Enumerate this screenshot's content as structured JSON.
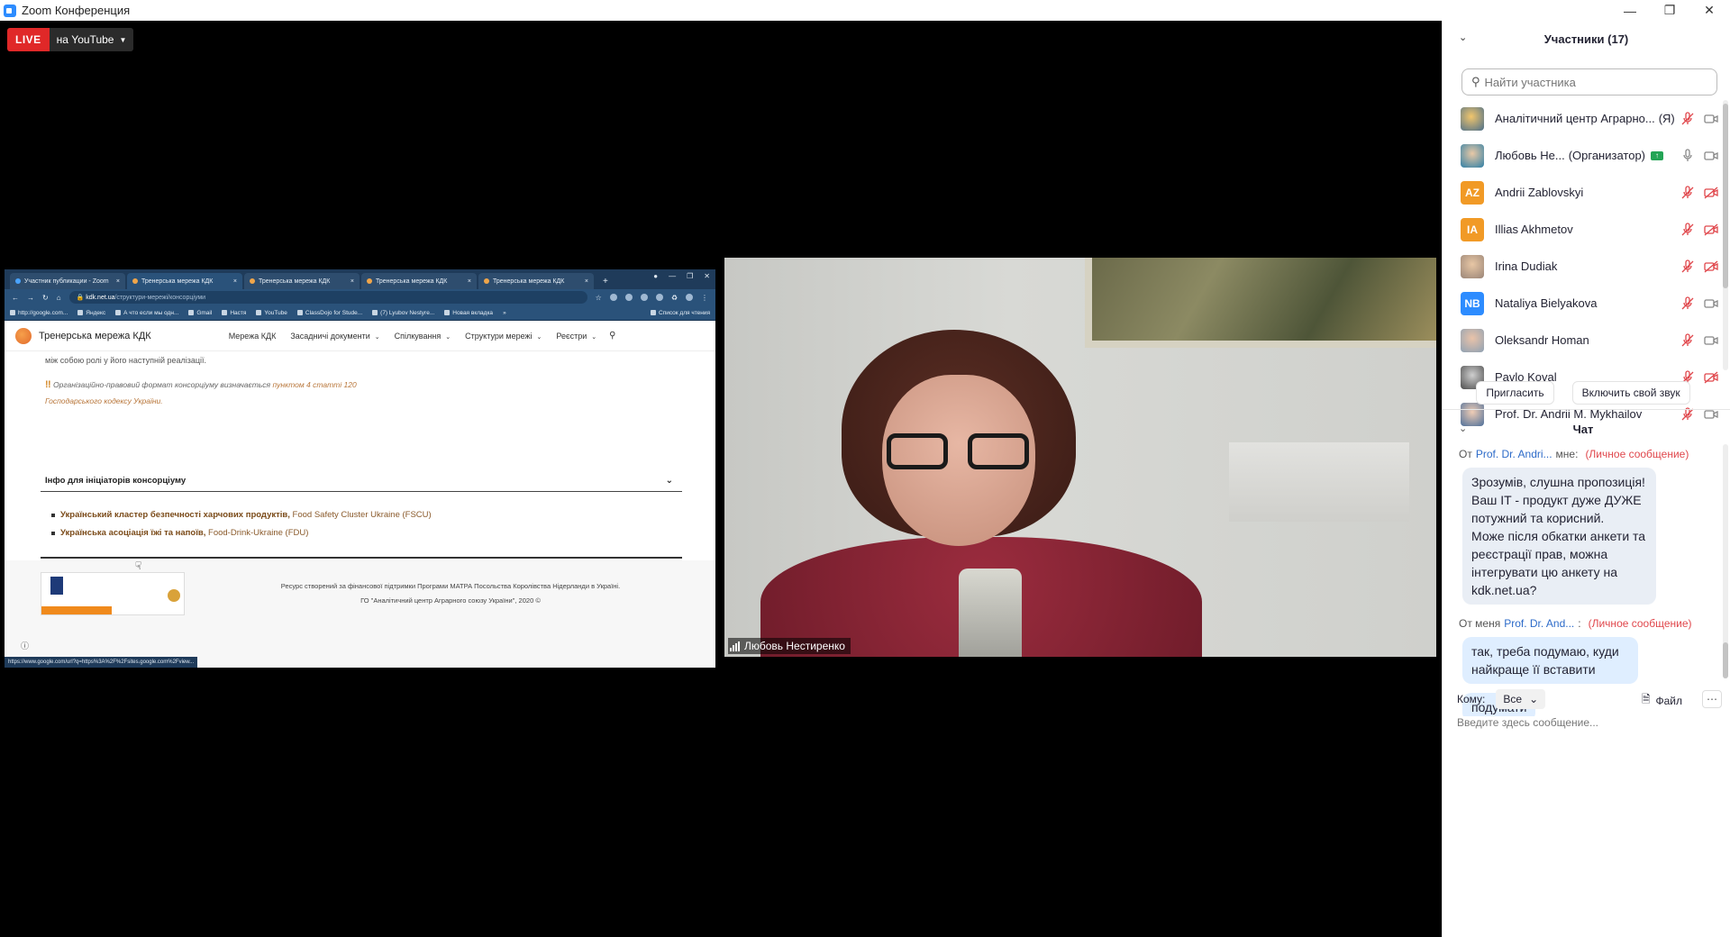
{
  "window": {
    "title": "Zoom Конференция"
  },
  "live": {
    "badge": "LIVE",
    "destination": "на YouTube"
  },
  "browser": {
    "tabs": [
      {
        "label": "Участник публикации - Zoom"
      },
      {
        "label": "Тренерська мережа КДК"
      },
      {
        "label": "Тренерська мережа КДК"
      },
      {
        "label": "Тренерська мережа КДК"
      },
      {
        "label": "Тренерська мережа КДК"
      }
    ],
    "url_host": "kdk.net.ua",
    "url_path": "/структури-мережі/консорціуми",
    "bookmarks": [
      "http://google.com...",
      "Яндекс",
      "А что если мы одн...",
      "Gmail",
      "Настя",
      "YouTube",
      "ClassDojo for Stude...",
      "(7) Lyubov Nestyre...",
      "Новая вкладка"
    ],
    "reading_list": "Список для чтения",
    "status_url": "https://www.google.com/url?q=https%3A%2F%2Fsites.google.com%2Fview..."
  },
  "site": {
    "name": "Тренерська мережа КДК",
    "menu": [
      "Мережа КДК",
      "Засадничі документи",
      "Спілкування",
      "Структури мережі",
      "Реєстри"
    ],
    "para_tail": "між собою ролі у його наступній реалізації.",
    "note_prefix": "Організаційно-правовий формат консорціуму визначається ",
    "note_link": "пунктом 4 статті 120",
    "note_link2": "Господарського кодексу України.",
    "accordion": "Інфо для ініціаторів консорціуму",
    "list": [
      {
        "bold": "Український кластер безпечності харчових продуктів,",
        "normal": "Food Safety Cluster Ukraine (FSCU)"
      },
      {
        "bold": "Українська асоціація їжі та напоїв,",
        "normal": "Food-Drink-Ukraine (FDU)"
      }
    ],
    "footer_line1": "Ресурс створений за фінансової підтримки Програми МАТРА Посольства Королівства Нідерланди в Україні.",
    "footer_line2": "ГО \"Аналітичний центр Аграрного союзу України\", 2020 ©"
  },
  "video": {
    "name": "Любовь Нестиренко"
  },
  "participants": {
    "title": "Участники (17)",
    "search_placeholder": "Найти участника",
    "list": [
      {
        "name": "Аналітичний центр Аграрно...",
        "role": "(Я)",
        "initials": "",
        "avatar": "photo1",
        "mic": "muted",
        "cam": "on"
      },
      {
        "name": "Любовь Не...",
        "role": "(Организатор)",
        "initials": "",
        "avatar": "photo2",
        "mic": "on",
        "cam": "on"
      },
      {
        "name": "Andrii Zablovskyi",
        "role": "",
        "initials": "AZ",
        "avatar": "orange",
        "mic": "muted",
        "cam": "off"
      },
      {
        "name": "Illias Akhmetov",
        "role": "",
        "initials": "IA",
        "avatar": "orange",
        "mic": "muted",
        "cam": "off"
      },
      {
        "name": "Irina Dudiak",
        "role": "",
        "initials": "",
        "avatar": "photo3",
        "mic": "muted",
        "cam": "off"
      },
      {
        "name": "Nataliya Bielyakova",
        "role": "",
        "initials": "NB",
        "avatar": "blue",
        "mic": "muted",
        "cam": "on"
      },
      {
        "name": "Oleksandr Homan",
        "role": "",
        "initials": "",
        "avatar": "photo4",
        "mic": "muted",
        "cam": "on"
      },
      {
        "name": "Pavlo Koval",
        "role": "",
        "initials": "",
        "avatar": "photo5",
        "mic": "muted",
        "cam": "off"
      },
      {
        "name": "Prof. Dr. Andrii M. Mykhailov",
        "role": "",
        "initials": "",
        "avatar": "photo6",
        "mic": "muted",
        "cam": "on"
      }
    ],
    "invite": "Пригласить",
    "unmute": "Включить свой звук"
  },
  "chat": {
    "title": "Чат",
    "messages": [
      {
        "prefix": "От",
        "who": "Prof. Dr. Andri...",
        "to": "мне:",
        "priv": "(Личное сообщение)",
        "text": "Зрозумів, слушна пропозиція!\nВаш IT - продукт дуже ДУЖЕ потужний та корисний.\nМоже після обкатки анкети та реєстрації прав, можна інтегрувати цю анкету на kdk.net.ua?"
      },
      {
        "prefix": "От меня",
        "who": "Prof. Dr. And...",
        "to": ":",
        "priv": "(Личное сообщение)",
        "text": "так, треба подумаю, куди найкраще її вставити"
      },
      {
        "text": "подумати"
      }
    ],
    "to_label": "Кому:",
    "to_value": "Все",
    "file_label": "Файл",
    "input_placeholder": "Введите здесь сообщение..."
  },
  "colors": {
    "accent": "#2d8cff",
    "live": "#e02828",
    "muted": "#e0474c",
    "private": "#e0474c"
  }
}
